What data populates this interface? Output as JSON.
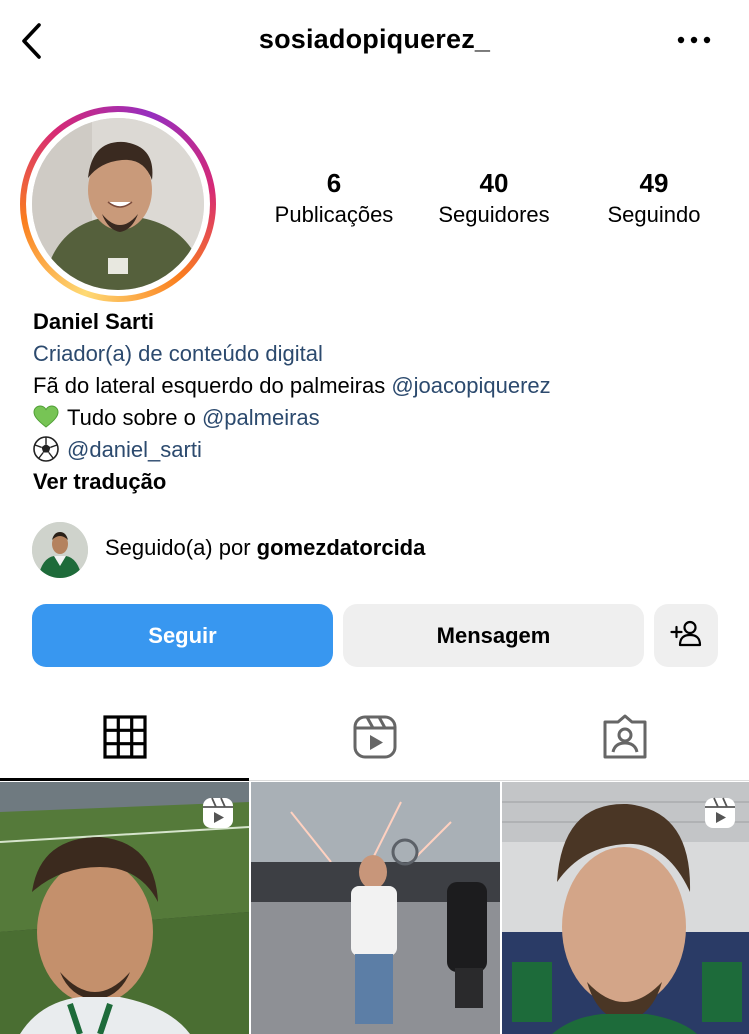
{
  "header": {
    "username": "sosiadopiquerez_"
  },
  "stats": [
    {
      "value": "6",
      "label": "Publicações"
    },
    {
      "value": "40",
      "label": "Seguidores"
    },
    {
      "value": "49",
      "label": "Seguindo"
    }
  ],
  "bio": {
    "name": "Daniel Sarti",
    "category": "Criador(a) de conteúdo digital",
    "line1_text": "Fã do lateral esquerdo do palmeiras ",
    "line1_mention": "@joacopiquerez",
    "line2_text": "Tudo sobre o ",
    "line2_mention": "@palmeiras",
    "line3_mention": "@daniel_sarti",
    "translate": "Ver tradução"
  },
  "followed_by": {
    "prefix": "Seguido(a) por ",
    "user": "gomezdatorcida"
  },
  "buttons": {
    "follow": "Seguir",
    "message": "Mensagem"
  },
  "tabs": [
    "grid-icon",
    "reels-icon",
    "tagged-icon"
  ],
  "active_tab": "grid",
  "colors": {
    "accent": "#3897f0",
    "link": "#2c4a6e",
    "secondary_button": "#efefef"
  },
  "posts": [
    {
      "type": "reel"
    },
    {
      "type": "photo"
    },
    {
      "type": "reel"
    }
  ]
}
